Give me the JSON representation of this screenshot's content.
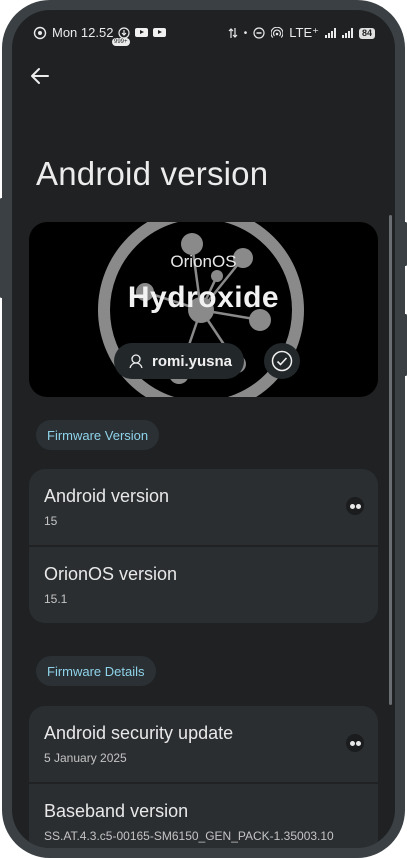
{
  "status_bar": {
    "time": "Mon 12.52",
    "notification_count": "999+",
    "network": "LTE⁺",
    "battery": "84"
  },
  "header": {
    "back_icon": "arrow-back-icon",
    "title": "Android version"
  },
  "banner": {
    "os_name": "OrionOS",
    "edition": "Hydroxide",
    "username": "romi.yusna"
  },
  "sections": [
    {
      "chip": "Firmware Version",
      "items": [
        {
          "title": "Android version",
          "value": "15"
        },
        {
          "title": "OrionOS version",
          "value": "15.1"
        }
      ]
    },
    {
      "chip": "Firmware Details",
      "items": [
        {
          "title": "Android security update",
          "value": "5 January 2025"
        },
        {
          "title": "Baseband version",
          "value": "SS.AT.4.3.c5-00165-SM6150_GEN_PACK-1.35003.10"
        }
      ]
    }
  ],
  "colors": {
    "background": "#1f2123",
    "card": "#2a2e31",
    "chip_text": "#8fd3ea"
  }
}
